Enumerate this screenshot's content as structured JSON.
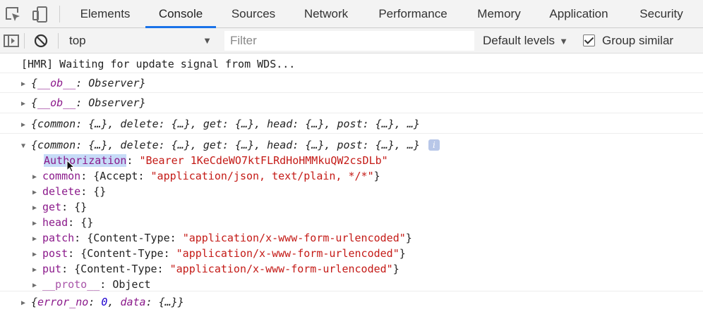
{
  "tabs": [
    {
      "label": "Elements"
    },
    {
      "label": "Console"
    },
    {
      "label": "Sources"
    },
    {
      "label": "Network"
    },
    {
      "label": "Performance"
    },
    {
      "label": "Memory"
    },
    {
      "label": "Application"
    },
    {
      "label": "Security"
    }
  ],
  "active_tab": "Console",
  "toolbar": {
    "context": "top",
    "filter_placeholder": "Filter",
    "levels_label": "Default levels",
    "group_similar_label": "Group similar",
    "group_similar_checked": true
  },
  "messages": {
    "hmr": "[HMR] Waiting for update signal from WDS...",
    "obs1": {
      "key": "__ob__",
      "value": "Observer"
    },
    "obs2": {
      "key": "__ob__",
      "value": "Observer"
    },
    "obj_collapsed": "{common: {…}, delete: {…}, get: {…}, head: {…}, post: {…}, …}",
    "obj_expanded": {
      "summary": "{common: {…}, delete: {…}, get: {…}, head: {…}, post: {…}, …}",
      "info_badge": "i",
      "authorization": {
        "key": "Authorization",
        "value": "\"Bearer 1KeCdeWO7ktFLRdHoHMMkuQW2csDLb\""
      },
      "common": {
        "key": "common",
        "pre": "{Accept: ",
        "value": "\"application/json, text/plain, */*\"",
        "post": "}"
      },
      "delete": {
        "key": "delete",
        "value": "{}"
      },
      "get": {
        "key": "get",
        "value": "{}"
      },
      "head": {
        "key": "head",
        "value": "{}"
      },
      "patch": {
        "key": "patch",
        "pre": "{Content-Type: ",
        "value": "\"application/x-www-form-urlencoded\"",
        "post": "}"
      },
      "post": {
        "key": "post",
        "pre": "{Content-Type: ",
        "value": "\"application/x-www-form-urlencoded\"",
        "post": "}"
      },
      "put": {
        "key": "put",
        "pre": "{Content-Type: ",
        "value": "\"application/x-www-form-urlencoded\"",
        "post": "}"
      },
      "proto": {
        "key": "__proto__",
        "value": "Object"
      }
    },
    "last": {
      "key1": "error_no",
      "val1": "0",
      "key2": "data",
      "val2": "{…}"
    }
  },
  "colors": {
    "active_tab_underline": "#1a73e8",
    "string": "#c41a16",
    "key": "#8b1a8b",
    "number": "#1c00cf",
    "highlight": "#c6dbf7"
  },
  "icons": [
    "inspect-element-icon",
    "device-toolbar-icon",
    "sidebar-toggle-icon",
    "clear-console-icon",
    "dropdown-arrow-icon",
    "checkbox-icon",
    "info-icon",
    "expand-triangle-icon",
    "collapse-triangle-icon",
    "mouse-cursor-icon"
  ]
}
